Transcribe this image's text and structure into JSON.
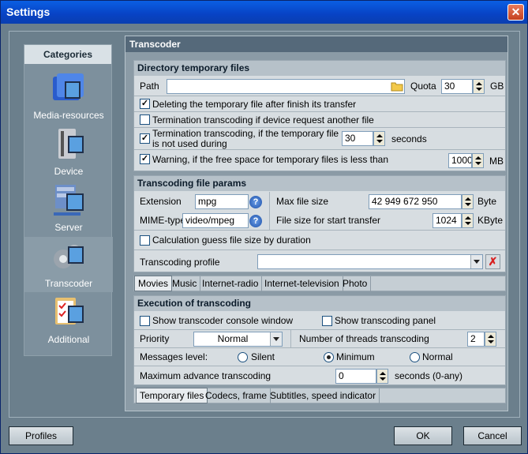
{
  "window": {
    "title": "Settings"
  },
  "categories": {
    "title": "Categories",
    "items": [
      {
        "label": "Media-resources",
        "icon": "media-resources-icon"
      },
      {
        "label": "Device",
        "icon": "device-icon"
      },
      {
        "label": "Server",
        "icon": "server-icon"
      },
      {
        "label": "Transcoder",
        "icon": "transcoder-icon"
      },
      {
        "label": "Additional",
        "icon": "additional-icon"
      }
    ],
    "selected": "Transcoder"
  },
  "panel": {
    "title": "Transcoder"
  },
  "directory": {
    "title": "Directory temporary files",
    "path_label": "Path",
    "path_value": "",
    "quota_label": "Quota",
    "quota_value": "30",
    "quota_unit": "GB",
    "delete_label": "Deleting the temporary file after finish its transfer",
    "delete_checked": true,
    "terminate_request_label": "Termination transcoding if device request another file",
    "terminate_request_checked": false,
    "terminate_unused_label": "Termination transcoding, if the temporary file is not used during",
    "terminate_unused_checked": true,
    "terminate_unused_value": "30",
    "terminate_unused_unit": "seconds",
    "warning_label": "Warning, if the free space for temporary files is less than",
    "warning_checked": true,
    "warning_value": "1000",
    "warning_unit": "MB"
  },
  "params": {
    "title": "Transcoding file params",
    "extension_label": "Extension",
    "extension_value": "mpg",
    "mime_label": "MIME-type",
    "mime_value": "video/mpeg",
    "max_size_label": "Max file size",
    "max_size_value": "42 949 672 950",
    "max_size_unit": "Byte",
    "start_size_label": "File size for start transfer",
    "start_size_value": "1024",
    "start_size_unit": "KByte",
    "guess_label": "Calculation guess file size by duration",
    "guess_checked": false,
    "profile_label": "Transcoding profile",
    "profile_value": ""
  },
  "media_tabs": [
    "Movies",
    "Music",
    "Internet-radio",
    "Internet-television",
    "Photo"
  ],
  "media_tab_selected": "Movies",
  "execution": {
    "title": "Execution of transcoding",
    "console_label": "Show transcoder console window",
    "console_checked": false,
    "panel_label": "Show transcoding panel",
    "panel_checked": false,
    "priority_label": "Priority",
    "priority_value": "Normal",
    "threads_label": "Number of threads transcoding",
    "threads_value": "2",
    "messages_label": "Messages level:",
    "messages_options": [
      "Silent",
      "Minimum",
      "Normal"
    ],
    "messages_selected": "Minimum",
    "advance_label": "Maximum advance transcoding",
    "advance_value": "0",
    "advance_unit": "seconds (0-any)"
  },
  "bottom_tabs": [
    "Temporary files",
    "Codecs, frame",
    "Subtitles, speed indicator"
  ],
  "bottom_tab_selected": "Temporary files",
  "buttons": {
    "profiles": "Profiles",
    "ok": "OK",
    "cancel": "Cancel"
  },
  "colors": {
    "titlebar": "#0a50d8",
    "background": "#6b7f8c",
    "panel": "#d7dde1"
  }
}
